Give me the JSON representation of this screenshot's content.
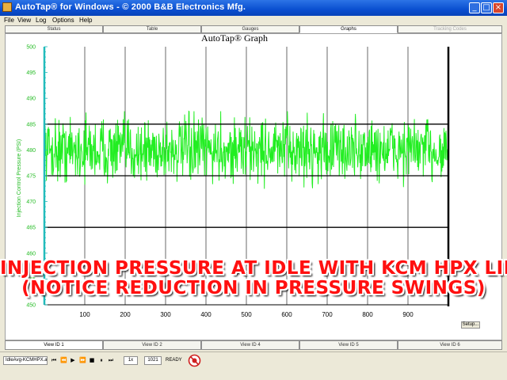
{
  "window": {
    "title": "AutoTap® for Windows - © 2000 B&B Electronics Mfg.",
    "buttons": {
      "minimize": "_",
      "maximize": "□",
      "close": "×"
    }
  },
  "menu": [
    "File",
    "View",
    "Log",
    "Options",
    "Help"
  ],
  "view_tabs": [
    {
      "label": "Status",
      "state": "normal"
    },
    {
      "label": "Table",
      "state": "normal"
    },
    {
      "label": "Gauges",
      "state": "normal"
    },
    {
      "label": "Graphs",
      "state": "active"
    },
    {
      "label": "Tracking Codes",
      "state": "disabled"
    }
  ],
  "chart_data": {
    "type": "line",
    "title": "AutoTap® Graph",
    "ylabel": "Injection Control Pressure (PSI)",
    "xlabel": "",
    "xlim": [
      0,
      1000
    ],
    "ylim": [
      450,
      500
    ],
    "x_ticks": [
      100,
      200,
      300,
      400,
      500,
      600,
      700,
      800,
      900
    ],
    "y_ticks": [
      "500",
      "495",
      "490",
      "485",
      "480",
      "475",
      "470",
      "465",
      "460",
      "455",
      "450"
    ],
    "y_tick_values": [
      500,
      495,
      490,
      485,
      480,
      475,
      470,
      465,
      460,
      455,
      450
    ],
    "grid": true,
    "reference_lines": [
      {
        "y": 485,
        "color": "#000000"
      },
      {
        "y": 475,
        "color": "#000000"
      },
      {
        "y": 465,
        "color": "#000000"
      }
    ],
    "series": [
      {
        "color": "#22ee22",
        "mean": 480,
        "spread": 3.6,
        "samples": 1000,
        "y_min": 472,
        "y_max": 487.5
      }
    ]
  },
  "overlay_caption": [
    "INJECTION PRESSURE AT IDLE WITH KCM HPX LINE",
    "(NOTICE REDUCTION IN PRESSURE SWINGS)"
  ],
  "setup_button": "Setup...",
  "bottom_tabs": [
    {
      "label": "View ID 1",
      "state": "active"
    },
    {
      "label": "View ID 2",
      "state": "normal"
    },
    {
      "label": "View ID 4",
      "state": "normal"
    },
    {
      "label": "View ID 5",
      "state": "normal"
    },
    {
      "label": "View ID 6",
      "state": "normal"
    }
  ],
  "status_bar": {
    "file_name": "IdleAvg-KCMHPX.atl",
    "speed_label": "1x",
    "position_label": "1021",
    "mode_label": "READY"
  },
  "colors": {
    "trace": "#22ee22",
    "axis": "#22bbbb",
    "caption": "#ff1010",
    "title_bar": "#0a4fd0"
  }
}
